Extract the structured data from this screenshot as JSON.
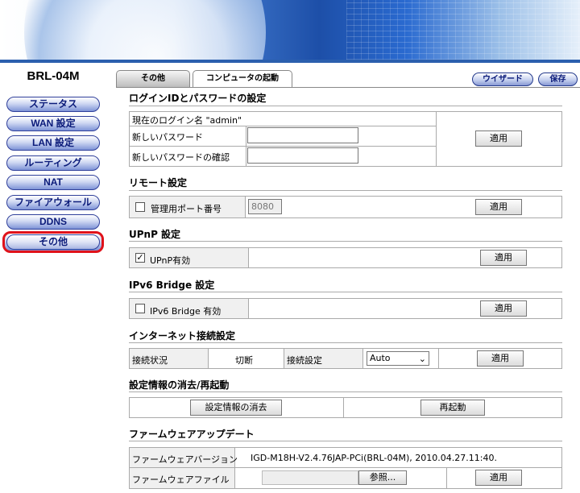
{
  "sidebar": {
    "model": "BRL-04M",
    "items": [
      {
        "label": "ステータス"
      },
      {
        "label": "WAN 設定"
      },
      {
        "label": "LAN 設定"
      },
      {
        "label": "ルーティング"
      },
      {
        "label": "NAT"
      },
      {
        "label": "ファイアウォール"
      },
      {
        "label": "DDNS"
      },
      {
        "label": "その他"
      }
    ]
  },
  "tabs": [
    {
      "label": "その他"
    },
    {
      "label": "コンピュータの起動"
    }
  ],
  "toolbar": {
    "wizard": "ウイザード",
    "save": "保存"
  },
  "login": {
    "title": "ログインIDとパスワードの設定",
    "current": "現在のログイン名 \"admin\"",
    "new_password": "新しいパスワード",
    "confirm_password": "新しいパスワードの確認",
    "apply": "適用"
  },
  "remote": {
    "title": "リモート設定",
    "port_label": "管理用ポート番号",
    "port_value": "8080",
    "checked": false,
    "apply": "適用"
  },
  "upnp": {
    "title": "UPnP 設定",
    "label": "UPnP有効",
    "checked": true,
    "apply": "適用"
  },
  "ipv6": {
    "title": "IPv6 Bridge 設定",
    "label": "IPv6 Bridge 有効",
    "checked": false,
    "apply": "適用"
  },
  "internet": {
    "title": "インターネット接続設定",
    "status_label": "接続状況",
    "status_value": "切断",
    "setting_label": "接続設定",
    "setting_value": "Auto",
    "apply": "適用"
  },
  "reset": {
    "title": "設定情報の消去/再起動",
    "clear": "設定情報の消去",
    "reboot": "再起動"
  },
  "firmware": {
    "title": "ファームウェアアップデート",
    "version_label": "ファームウェアバージョン",
    "version_value": "IGD-M18H-V2.4.76JAP-PCi(BRL-04M), 2010.04.27.11:40.",
    "file_label": "ファームウェアファイル",
    "browse": "参照...",
    "apply": "適用"
  }
}
